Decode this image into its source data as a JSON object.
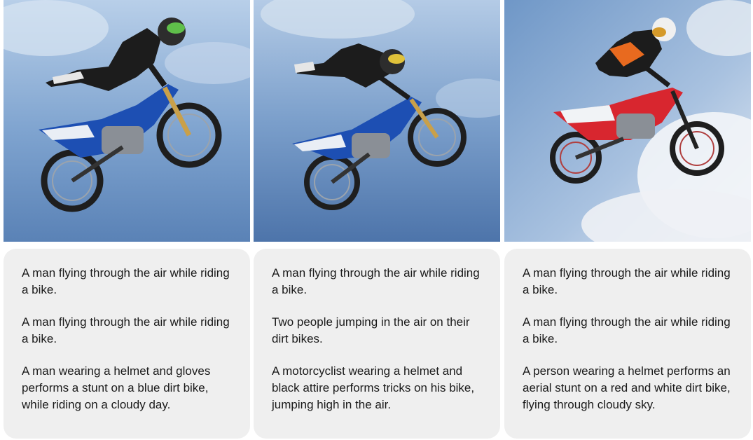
{
  "panels": [
    {
      "image_subject": "motocross-rider-blue-bike",
      "captions": [
        "A man flying through the air while riding a bike.",
        "A man flying through the air while riding a bike.",
        "A man wearing a helmet and gloves performs a stunt on a blue dirt bike, while riding on a cloudy day."
      ]
    },
    {
      "image_subject": "motocross-rider-blue-bike",
      "captions": [
        "A man flying through the air while riding a bike.",
        "Two people jumping in the air on their dirt bikes.",
        "A motorcyclist wearing a helmet and black attire performs tricks on his bike, jumping high in the air."
      ]
    },
    {
      "image_subject": "motocross-rider-red-bike",
      "captions": [
        "A man flying through the air while riding a bike.",
        "A man flying through the air while riding a bike.",
        "A person wearing a helmet performs an aerial stunt on a red and white dirt bike, flying through cloudy sky."
      ]
    }
  ],
  "colors": {
    "sky_top": "#a9c3e2",
    "sky_bottom": "#5f86b8",
    "bike_blue": "#1d4fb3",
    "bike_red": "#d8262f",
    "card_bg": "#efefef"
  }
}
